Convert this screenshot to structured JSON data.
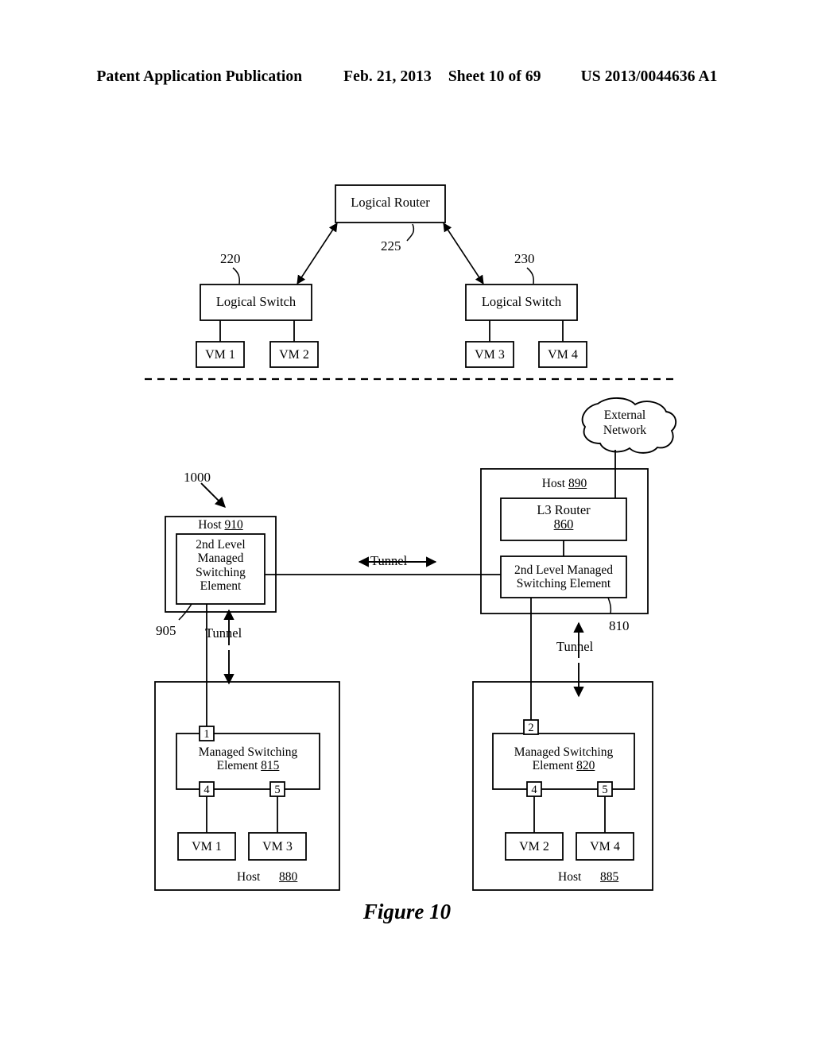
{
  "header": {
    "publication": "Patent Application Publication",
    "date": "Feb. 21, 2013",
    "sheet": "Sheet 10 of 69",
    "patent_number": "US 2013/0044636 A1"
  },
  "figure": {
    "caption": "Figure 10",
    "reference_numeral": "1000"
  },
  "logical_view": {
    "router": {
      "label": "Logical Router",
      "ref": "225"
    },
    "switch_left": {
      "label": "Logical Switch",
      "ref": "220"
    },
    "switch_right": {
      "label": "Logical Switch",
      "ref": "230"
    },
    "vms": [
      {
        "label": "VM 1"
      },
      {
        "label": "VM 2"
      },
      {
        "label": "VM 3"
      },
      {
        "label": "VM 4"
      }
    ]
  },
  "physical_view": {
    "external_network": {
      "line1": "External",
      "line2": "Network"
    },
    "host_910": {
      "title_word": "Host",
      "title_ref": "910",
      "ref_leader": "905",
      "element": {
        "line1": "2nd Level",
        "line2": "Managed",
        "line3": "Switching",
        "line4": "Element"
      }
    },
    "host_890": {
      "title_word": "Host",
      "title_ref": "890",
      "l3_router": {
        "label": "L3 Router",
        "ref": "860"
      },
      "element": {
        "line1": "2nd Level Managed",
        "line2": "Switching Element",
        "ref": "810"
      }
    },
    "host_880": {
      "title_word": "Host",
      "title_ref": "880",
      "switching_element": {
        "line1": "Managed Switching",
        "line2_word": "Element",
        "line2_ref": "815"
      },
      "ports": {
        "uplink": "1",
        "vm_left": "4",
        "vm_right": "5"
      },
      "vms": [
        {
          "label": "VM 1"
        },
        {
          "label": "VM 3"
        }
      ]
    },
    "host_885": {
      "title_word": "Host",
      "title_ref": "885",
      "switching_element": {
        "line1": "Managed Switching",
        "line2_word": "Element",
        "line2_ref": "820"
      },
      "ports": {
        "uplink": "2",
        "vm_left": "4",
        "vm_right": "5"
      },
      "vms": [
        {
          "label": "VM 2"
        },
        {
          "label": "VM 4"
        }
      ]
    },
    "tunnel_labels": {
      "horizontal": "Tunnel",
      "left_vertical": "Tunnel",
      "right_vertical": "Tunnel"
    }
  }
}
